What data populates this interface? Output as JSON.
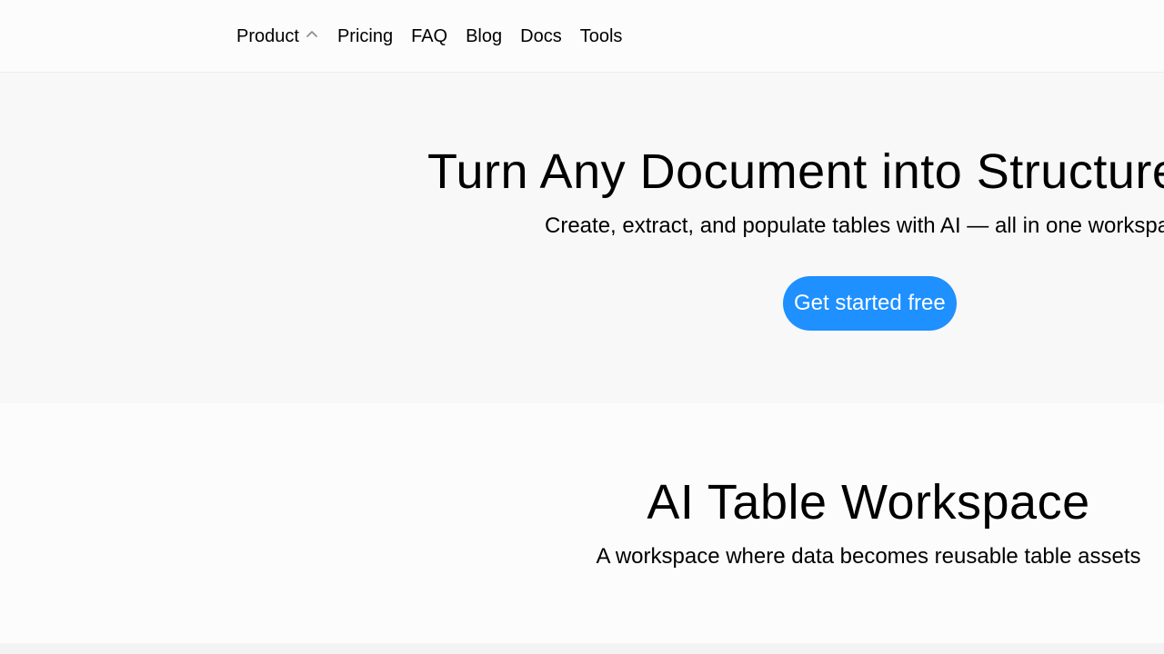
{
  "nav": {
    "items": [
      {
        "label": "Product",
        "has_dropdown": true,
        "icon": "chevron-up-icon"
      },
      {
        "label": "Pricing"
      },
      {
        "label": "FAQ"
      },
      {
        "label": "Blog"
      },
      {
        "label": "Docs"
      },
      {
        "label": "Tools"
      }
    ]
  },
  "hero": {
    "title": "Turn Any Document into Structured",
    "subtitle": "Create, extract, and populate tables with AI — all in one workspa",
    "cta_label": "Get started free",
    "cta_color": "#1e90ff"
  },
  "section2": {
    "title": "AI Table Workspace",
    "subtitle": "A workspace where data becomes reusable table assets"
  }
}
